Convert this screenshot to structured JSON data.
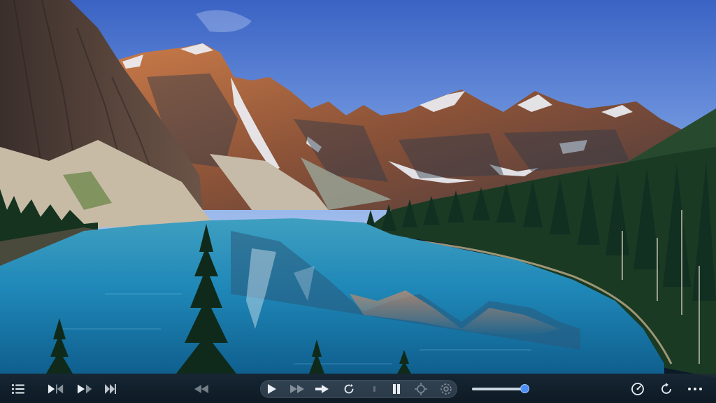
{
  "player": {
    "accent_color": "#4d8ff7",
    "icon_color": "#e8eef3",
    "volume_level": 0.99
  },
  "controls": {
    "left": [
      {
        "name": "playlist-menu",
        "icon": "list-icon"
      },
      {
        "name": "play-previous",
        "icon": "play-skip-back-icon"
      },
      {
        "name": "play-next",
        "icon": "play-skip-forward-icon"
      },
      {
        "name": "skip-to-end",
        "icon": "skip-end-icon"
      }
    ],
    "center": [
      {
        "name": "rewind",
        "icon": "rewind-icon"
      },
      {
        "name": "play",
        "icon": "play-icon"
      },
      {
        "name": "fast-forward",
        "icon": "fast-forward-icon"
      },
      {
        "name": "step-forward",
        "icon": "step-forward-icon"
      },
      {
        "name": "loop",
        "icon": "loop-icon"
      },
      {
        "name": "pause",
        "icon": "pause-icon"
      },
      {
        "name": "crop",
        "icon": "crop-icon"
      },
      {
        "name": "rotate",
        "icon": "rotate-icon"
      }
    ],
    "right": [
      {
        "name": "speed",
        "icon": "speedometer-icon"
      },
      {
        "name": "repeat",
        "icon": "repeat-icon"
      },
      {
        "name": "more-options",
        "icon": "more-horizontal-icon"
      }
    ]
  }
}
